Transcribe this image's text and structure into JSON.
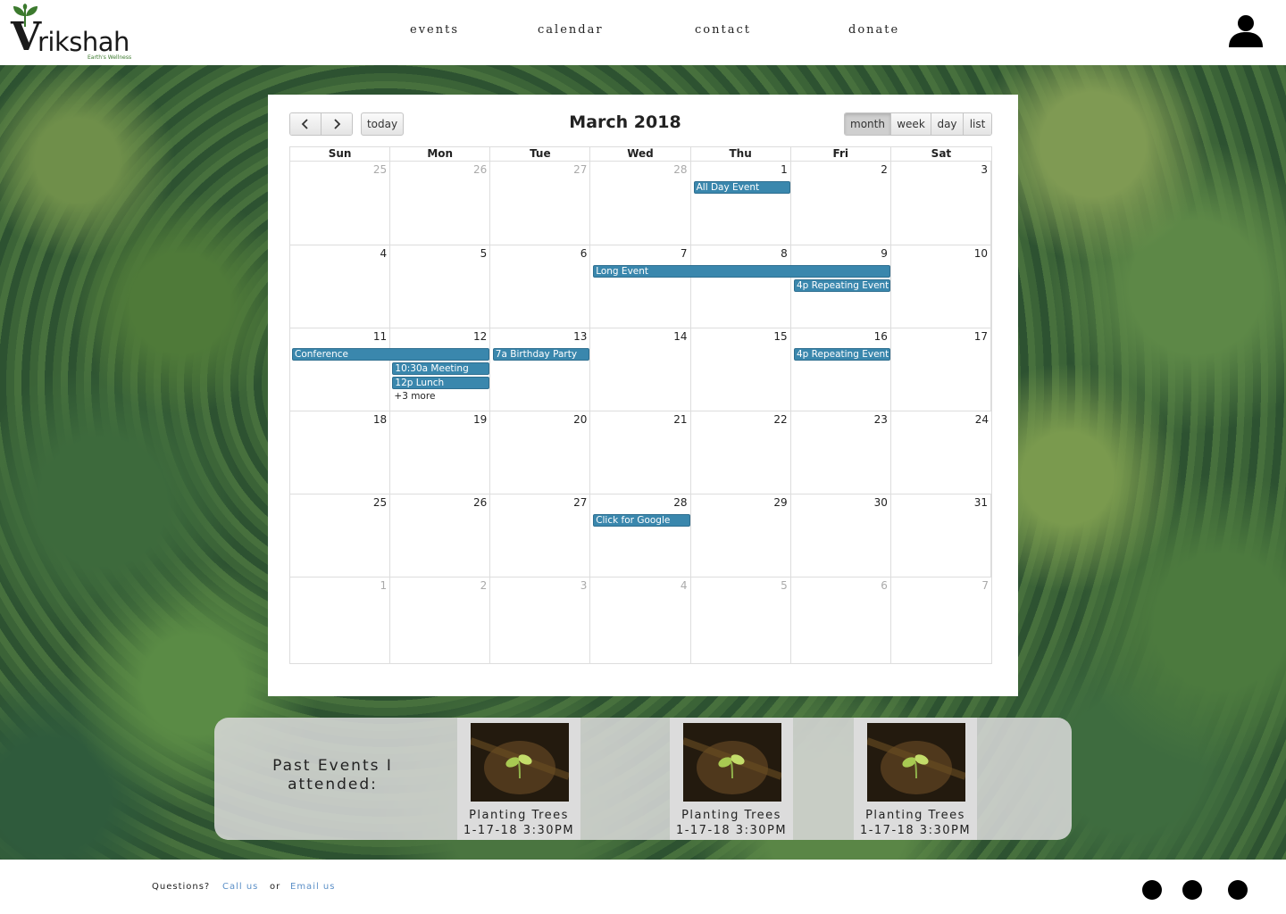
{
  "brand": {
    "logo_letter": "V",
    "logo_word": "rikshah",
    "tagline": "Earth's Wellness",
    "accent": "#3c7a2e"
  },
  "nav": {
    "items": [
      "events",
      "calendar",
      "contact",
      "donate"
    ]
  },
  "user_icon": "user-icon",
  "calendar": {
    "title": "March 2018",
    "prev_icon": "chevron-left-icon",
    "next_icon": "chevron-right-icon",
    "today_label": "today",
    "views": [
      {
        "label": "month",
        "active": true
      },
      {
        "label": "week",
        "active": false
      },
      {
        "label": "day",
        "active": false
      },
      {
        "label": "list",
        "active": false
      }
    ],
    "weekdays": [
      "Sun",
      "Mon",
      "Tue",
      "Wed",
      "Thu",
      "Fri",
      "Sat"
    ],
    "event_color": "#3a87ad",
    "weeks": [
      {
        "days": [
          {
            "n": "25",
            "other": true
          },
          {
            "n": "26",
            "other": true
          },
          {
            "n": "27",
            "other": true
          },
          {
            "n": "28",
            "other": true
          },
          {
            "n": "1"
          },
          {
            "n": "2"
          },
          {
            "n": "3"
          }
        ]
      },
      {
        "days": [
          {
            "n": "4"
          },
          {
            "n": "5"
          },
          {
            "n": "6"
          },
          {
            "n": "7"
          },
          {
            "n": "8"
          },
          {
            "n": "9"
          },
          {
            "n": "10"
          }
        ]
      },
      {
        "days": [
          {
            "n": "11"
          },
          {
            "n": "12"
          },
          {
            "n": "13"
          },
          {
            "n": "14"
          },
          {
            "n": "15"
          },
          {
            "n": "16"
          },
          {
            "n": "17"
          }
        ]
      },
      {
        "days": [
          {
            "n": "18"
          },
          {
            "n": "19"
          },
          {
            "n": "20"
          },
          {
            "n": "21"
          },
          {
            "n": "22"
          },
          {
            "n": "23"
          },
          {
            "n": "24"
          }
        ]
      },
      {
        "days": [
          {
            "n": "25"
          },
          {
            "n": "26"
          },
          {
            "n": "27"
          },
          {
            "n": "28"
          },
          {
            "n": "29"
          },
          {
            "n": "30"
          },
          {
            "n": "31"
          }
        ]
      },
      {
        "days": [
          {
            "n": "1",
            "other": true
          },
          {
            "n": "2",
            "other": true
          },
          {
            "n": "3",
            "other": true
          },
          {
            "n": "4",
            "other": true
          },
          {
            "n": "5",
            "other": true
          },
          {
            "n": "6",
            "other": true
          },
          {
            "n": "7",
            "other": true
          }
        ]
      }
    ],
    "events": [
      {
        "week": 0,
        "start": 4,
        "span": 1,
        "row": 0,
        "label": "All Day Event"
      },
      {
        "week": 1,
        "start": 3,
        "span": 3,
        "row": 0,
        "label": "Long Event"
      },
      {
        "week": 1,
        "start": 5,
        "span": 1,
        "row": 1,
        "label": "4p Repeating Event"
      },
      {
        "week": 2,
        "start": 0,
        "span": 2,
        "row": 0,
        "label": "Conference"
      },
      {
        "week": 2,
        "start": 2,
        "span": 1,
        "row": 0,
        "label": "7a Birthday Party"
      },
      {
        "week": 2,
        "start": 1,
        "span": 1,
        "row": 1,
        "label": "10:30a Meeting"
      },
      {
        "week": 2,
        "start": 1,
        "span": 1,
        "row": 2,
        "label": "12p Lunch"
      },
      {
        "week": 2,
        "start": 5,
        "span": 1,
        "row": 0,
        "label": "4p Repeating Event"
      },
      {
        "week": 4,
        "start": 3,
        "span": 1,
        "row": 0,
        "label": "Click for Google"
      }
    ],
    "more": {
      "week": 2,
      "day": 1,
      "row": 3,
      "label": "+3 more"
    }
  },
  "past_events": {
    "heading": "Past Events I attended:",
    "items": [
      {
        "title": "Planting Trees",
        "date": "1-17-18 3:30PM"
      },
      {
        "title": "Planting Trees",
        "date": "1-17-18 3:30PM"
      },
      {
        "title": "Planting Trees",
        "date": "1-17-18 3:30PM"
      }
    ]
  },
  "footer": {
    "questions": "Questions?",
    "call": "Call us",
    "or": "or",
    "email": "Email us",
    "link_color": "#5b8fc7",
    "social_icons": [
      "social-icon-1",
      "social-icon-2",
      "social-icon-3"
    ]
  }
}
